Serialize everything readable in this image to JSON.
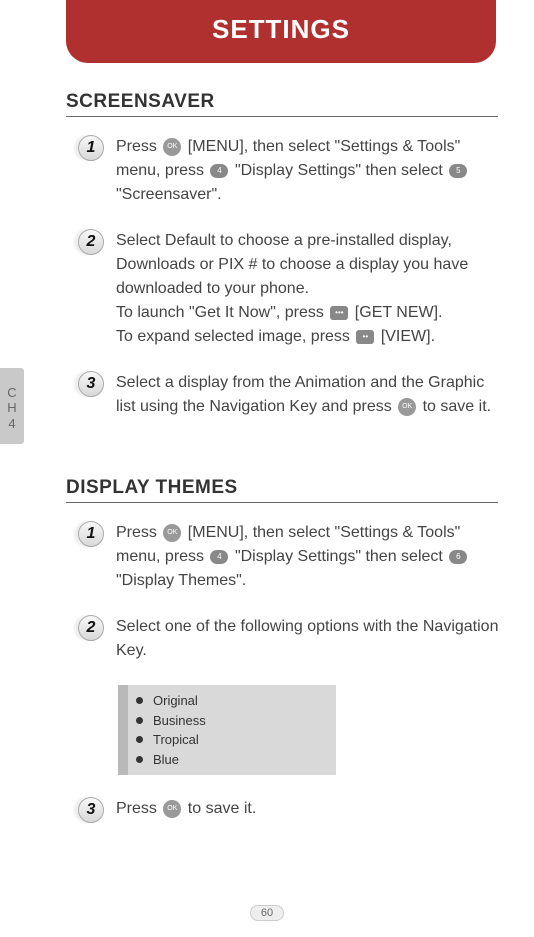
{
  "header": {
    "title": "SETTINGS"
  },
  "sideTab": {
    "line1": "C",
    "line2": "H",
    "line3": "4"
  },
  "sections": {
    "screensaver": {
      "title": "SCREENSAVER",
      "steps": {
        "s1": {
          "num": "1",
          "t1": "Press ",
          "t2": " [MENU], then select \"Settings & Tools\" menu, press ",
          "t3": " \"Display Settings\" then select ",
          "t4": " \"Screensaver\"."
        },
        "s2": {
          "num": "2",
          "t1": "Select Default to choose a pre-installed display, Downloads or PIX # to choose a display you have downloaded to your phone.",
          "t2": "To launch \"Get It Now\", press ",
          "t3": " [GET NEW].",
          "t4": "To expand selected image, press ",
          "t5": " [VIEW]."
        },
        "s3": {
          "num": "3",
          "t1": "Select a display from the Animation and the Graphic list using the Navigation Key and press ",
          "t2": " to save it."
        }
      }
    },
    "displayThemes": {
      "title": "DISPLAY THEMES",
      "steps": {
        "s1": {
          "num": "1",
          "t1": "Press ",
          "t2": " [MENU], then select \"Settings & Tools\" menu, press ",
          "t3": " \"Display Settings\" then select ",
          "t4": " \"Display Themes\"."
        },
        "s2": {
          "num": "2",
          "t1": "Select one of the following options with the Navigation Key."
        },
        "s3": {
          "num": "3",
          "t1": "Press ",
          "t2": " to save it."
        }
      },
      "options": {
        "o1": "Original",
        "o2": "Business",
        "o3": "Tropical",
        "o4": "Blue"
      }
    }
  },
  "icons": {
    "ok": "OK",
    "key4": "4",
    "key5": "5",
    "key6": "6",
    "dots3": "•••",
    "dots2": "••"
  },
  "pageNumber": "60"
}
